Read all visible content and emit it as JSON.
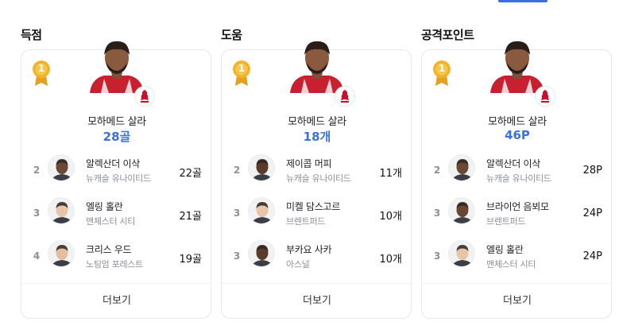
{
  "colors": {
    "accent": "#3b6fe3",
    "medal_gold": "#f5b82e",
    "muted": "#8a8f98"
  },
  "sections": [
    {
      "title": "득점",
      "rank_badge": "1",
      "leader": {
        "name": "모하메드 살라",
        "value": "28골",
        "club_icon": "liverpool-crest-icon"
      },
      "ranks": [
        {
          "rank": "2",
          "name": "알렉산더 이삭",
          "team": "뉴캐슬 유나이티드",
          "value": "22골",
          "skin": "#6b4a35"
        },
        {
          "rank": "3",
          "name": "엘링 홀란",
          "team": "맨체스터 시티",
          "value": "21골",
          "skin": "#e8c4a8"
        },
        {
          "rank": "4",
          "name": "크리스 우드",
          "team": "노팅엄 포레스트",
          "value": "19골",
          "skin": "#e6bfa0"
        }
      ],
      "more_label": "더보기"
    },
    {
      "title": "도움",
      "rank_badge": "1",
      "leader": {
        "name": "모하메드 살라",
        "value": "18개",
        "club_icon": "liverpool-crest-icon"
      },
      "ranks": [
        {
          "rank": "2",
          "name": "제이콥 머피",
          "team": "뉴캐슬 유나이티드",
          "value": "11개",
          "skin": "#5a3a28"
        },
        {
          "rank": "3",
          "name": "미켈 담스고르",
          "team": "브렌트퍼드",
          "value": "10개",
          "skin": "#e9c5a6"
        },
        {
          "rank": "3",
          "name": "부카요 사카",
          "team": "아스널",
          "value": "10개",
          "skin": "#5b3b2a"
        }
      ],
      "more_label": "더보기"
    },
    {
      "title": "공격포인트",
      "rank_badge": "1",
      "leader": {
        "name": "모하메드 살라",
        "value": "46P",
        "club_icon": "liverpool-crest-icon"
      },
      "ranks": [
        {
          "rank": "2",
          "name": "알렉산더 이삭",
          "team": "뉴캐슬 유나이티드",
          "value": "28P",
          "skin": "#6b4a35"
        },
        {
          "rank": "3",
          "name": "브라이언 음뵈모",
          "team": "브렌트퍼드",
          "value": "24P",
          "skin": "#6a4532"
        },
        {
          "rank": "3",
          "name": "엘링 홀란",
          "team": "맨체스터 시티",
          "value": "24P",
          "skin": "#e8c4a8"
        }
      ],
      "more_label": "더보기"
    }
  ]
}
